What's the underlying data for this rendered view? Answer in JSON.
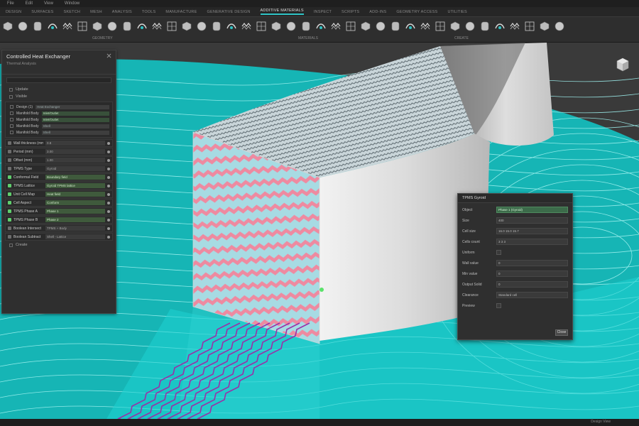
{
  "menubar": [
    "File",
    "Edit",
    "View",
    "Window"
  ],
  "ribbon": {
    "tabs": [
      "DESIGN",
      "SURFACES",
      "SKETCH",
      "MESH",
      "ANALYSIS",
      "TOOLS",
      "MANUFACTURE",
      "GENERATIVE DESIGN",
      "ADDITIVE MATERIALS",
      "INSPECT",
      "SCRIPTS",
      "ADD-INS",
      "GEOMETRY ACCESS",
      "UTILITIES"
    ],
    "active_tab_index": 8,
    "groups": [
      "GEOMETRY",
      "MATERIALS",
      "CREATE"
    ]
  },
  "left_panel": {
    "title": "Controlled Heat Exchanger",
    "subtitle": "Thermal Analysis",
    "options": [
      "Update",
      "Visible"
    ],
    "tree": [
      {
        "label": "Design (1)",
        "value": "Heat Exchanger",
        "green": false
      },
      {
        "label": "Manifold Body",
        "value": "Inlet/Outlet",
        "green": true
      },
      {
        "label": "Manifold Body",
        "value": "Inlet/Outlet",
        "green": true
      },
      {
        "label": "Manifold Body",
        "value": "Shell",
        "green": false
      },
      {
        "label": "Manifold Body",
        "value": "Shell",
        "green": false
      }
    ],
    "rows": [
      {
        "label": "Wall thickness (mm)",
        "value": "0.8",
        "green": false
      },
      {
        "label": "Period (mm)",
        "value": "3.00",
        "green": false
      },
      {
        "label": "Offset (mm)",
        "value": "1.00",
        "green": false
      },
      {
        "label": "TPMS Type",
        "value": "Gyroid",
        "green": false
      },
      {
        "label": "Conformal Field",
        "value": "Boundary field",
        "green": true
      },
      {
        "label": "TPMS Lattice",
        "value": "Gyroid TPMS lattice",
        "green": true
      },
      {
        "label": "Unit Cell Map",
        "value": "Heat field",
        "green": true
      },
      {
        "label": "Cell Aspect",
        "value": "Conform",
        "green": true
      },
      {
        "label": "TPMS Phase A",
        "value": "Phase 1",
        "green": true
      },
      {
        "label": "TPMS Phase B",
        "value": "Phase 2",
        "green": true
      },
      {
        "label": "Boolean Intersect",
        "value": "TPMS + Body",
        "green": false
      },
      {
        "label": "Boolean Subtract",
        "value": "Shell - Lattice",
        "green": false
      }
    ],
    "footer": "Create"
  },
  "dialog": {
    "title": "TPMS Gyroid",
    "rows": [
      {
        "key": "Object",
        "value": "Phase 1 (Gyroid)",
        "type": "select"
      },
      {
        "key": "Size",
        "value": "400",
        "type": "field"
      },
      {
        "key": "Cell size",
        "value": "16.0  15.0  15.7",
        "type": "triple"
      },
      {
        "key": "Cells count",
        "value": "3  3  3",
        "type": "triple"
      },
      {
        "key": "Uniform",
        "value": "",
        "type": "check"
      },
      {
        "key": "Wall value",
        "value": "0",
        "type": "field"
      },
      {
        "key": "Min value",
        "value": "0",
        "type": "field"
      },
      {
        "key": "Output Solid",
        "value": "0",
        "type": "field"
      },
      {
        "key": "Clearance",
        "value": "Standard cell",
        "type": "select"
      },
      {
        "key": "Preview",
        "value": "",
        "type": "check"
      }
    ],
    "close_label": "Close"
  },
  "status": {
    "right_text": "Design View"
  },
  "colors": {
    "accent": "#2ec4c6",
    "cyan_surface": "#1fc9c9",
    "pink_pattern": "#ee8aa0",
    "light_blue_pattern": "#a8dfe6",
    "purple_channel": "#9a2fa8",
    "body_grey": "#d9d9d9"
  },
  "icons": [
    "box-icon",
    "sphere-icon",
    "cylinder-icon",
    "lattice-icon",
    "gyroid-icon",
    "mesh-icon",
    "field-icon",
    "boolean-icon",
    "view-cube-icon"
  ]
}
